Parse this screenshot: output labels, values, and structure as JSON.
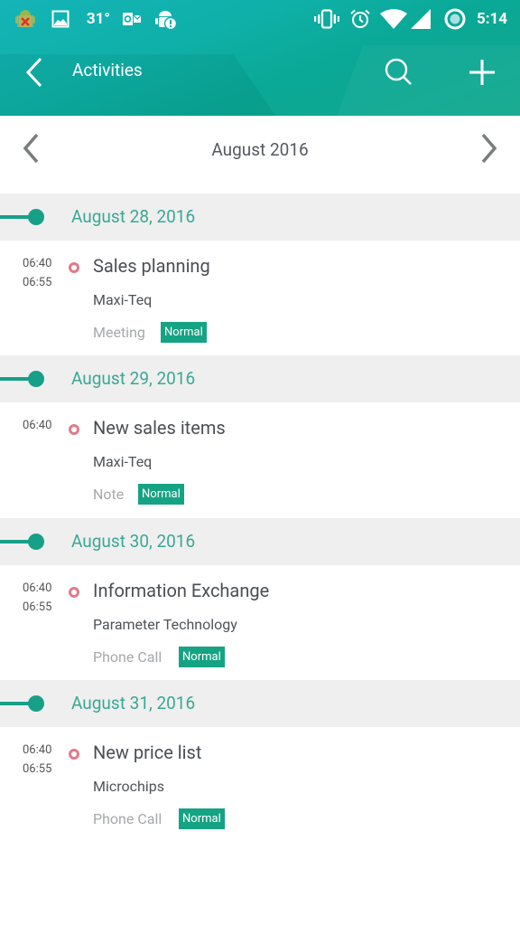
{
  "status_bar": {
    "notification_icons": [
      "android-error-icon",
      "image-icon",
      "outlook-icon",
      "android-alert-icon"
    ],
    "temperature": "31°",
    "system_icons": [
      "vibrate-icon",
      "alarm-icon",
      "wifi-icon",
      "cellular-signal-icon",
      "battery-saver-icon"
    ],
    "time": "5:14"
  },
  "app_bar": {
    "title": "Activities",
    "back_icon": "chevron-left-icon",
    "search_icon": "search-icon",
    "add_icon": "plus-icon"
  },
  "month_nav": {
    "label": "August 2016",
    "prev_icon": "chevron-left-icon",
    "next_icon": "chevron-right-icon"
  },
  "colors": {
    "accent": "#17a088",
    "date_text": "#3aa893",
    "badge": "#15a383",
    "status_ring": "#e07b8a",
    "day_header_bg": "#efefef"
  },
  "days": [
    {
      "date": "August 28, 2016",
      "activities": [
        {
          "start": "06:40",
          "end": "06:55",
          "title": "Sales planning",
          "company": "Maxi-Teq",
          "type": "Meeting",
          "priority": "Normal"
        }
      ]
    },
    {
      "date": "August 29, 2016",
      "activities": [
        {
          "start": "06:40",
          "end": "",
          "title": "New sales items",
          "company": "Maxi-Teq",
          "type": "Note",
          "priority": "Normal"
        }
      ]
    },
    {
      "date": "August 30, 2016",
      "activities": [
        {
          "start": "06:40",
          "end": "06:55",
          "title": "Information Exchange",
          "company": "Parameter Technology",
          "type": "Phone Call",
          "priority": "Normal"
        }
      ]
    },
    {
      "date": "August 31, 2016",
      "activities": [
        {
          "start": "06:40",
          "end": "06:55",
          "title": "New price list",
          "company": "Microchips",
          "type": "Phone Call",
          "priority": "Normal"
        }
      ]
    }
  ]
}
